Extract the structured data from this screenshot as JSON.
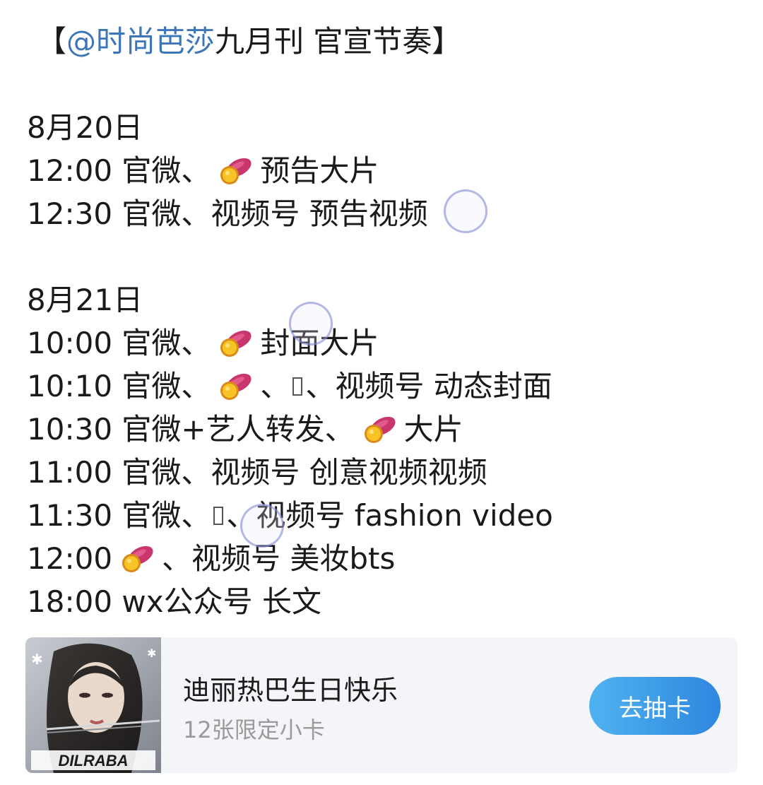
{
  "post": {
    "title_open": "【",
    "title_mention": "@时尚芭莎",
    "title_rest": " 九月刊 官宣节奏】",
    "day1": {
      "date": "8月20日",
      "l1_prefix": "12:00 官微、",
      "l1_suffix": "预告大片",
      "l2": "12:30 官微、视频号 预告视频"
    },
    "day2": {
      "date": "8月21日",
      "l1_prefix": "10:00 官微、",
      "l1_suffix": "封面大片",
      "l2_prefix": "10:10 官微、",
      "l2_mid": "、",
      "l2_suffix": "、视频号 动态封面",
      "l3_prefix": "10:30 官微+艺人转发、",
      "l3_suffix": "大片",
      "l4": "11:00  官微、视频号 创意视频视频",
      "l5_prefix": "11:30 官微、",
      "l5_suffix": "、视频号 fashion video",
      "l6_prefix": "12:00",
      "l6_suffix": "、视频号 美妆bts",
      "l7": "18:00 wx公众号 长文"
    }
  },
  "icons": {
    "sweet_potato": "sweet-potato-icon",
    "missing_emoji": "missing-emoji-icon"
  },
  "card": {
    "title": "迪丽热巴生日快乐",
    "subtitle": "12张限定小卡",
    "button_label": "去抽卡",
    "thumb_text": "DILRABA"
  },
  "colors": {
    "mention": "#3d76b8",
    "button_start": "#4fb3f0",
    "button_end": "#2f86df",
    "card_bg": "#f4f5f8"
  }
}
